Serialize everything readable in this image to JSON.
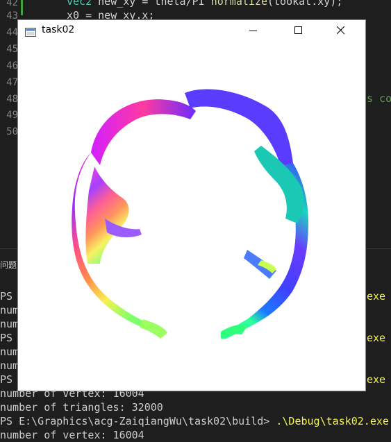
{
  "editor": {
    "line_numbers": [
      "42",
      "43",
      "44",
      "45",
      "46",
      "47",
      "48",
      "49",
      "50"
    ],
    "code_line_42": {
      "type": "vec2",
      "rest": " new_xy = theta/PI ",
      "fn": "normalize",
      "args": "(lookat.xy);"
    },
    "code_line_43": "x0 = new_xy.x;",
    "comment_fragment": "s co"
  },
  "panel": {
    "tab_label": "问题"
  },
  "terminal": {
    "lines": [
      {
        "text": "PS",
        "highlight": ""
      },
      {
        "text": "num",
        "highlight": ""
      },
      {
        "text": "num",
        "highlight": ""
      },
      {
        "text": "PS",
        "highlight": ""
      },
      {
        "text": "num",
        "highlight": ""
      },
      {
        "text": "num",
        "highlight": ""
      },
      {
        "text": "PS",
        "highlight": ""
      },
      {
        "text": "number of vertex: 16004",
        "highlight": ""
      },
      {
        "text": "number of triangles: 32000",
        "highlight": ""
      },
      {
        "text": "PS E:\\Graphics\\acg-ZaiqiangWu\\task02\\build> ",
        "highlight": ".\\Debug\\task02.exe"
      },
      {
        "text": "number of vertex: 16004",
        "highlight": ""
      }
    ],
    "exe_fragment": "exe"
  },
  "window": {
    "title": "task02",
    "icon": "app-window-icon",
    "controls": [
      "minimize-icon",
      "maximize-icon",
      "close-icon"
    ]
  },
  "colors": {
    "editor_bg": "#1e1e1e",
    "keyword": "#4ec9b0",
    "function": "#dcdcaa",
    "comment": "#6a9955",
    "terminal_highlight": "#f5f543",
    "window_bg": "#ffffff"
  }
}
